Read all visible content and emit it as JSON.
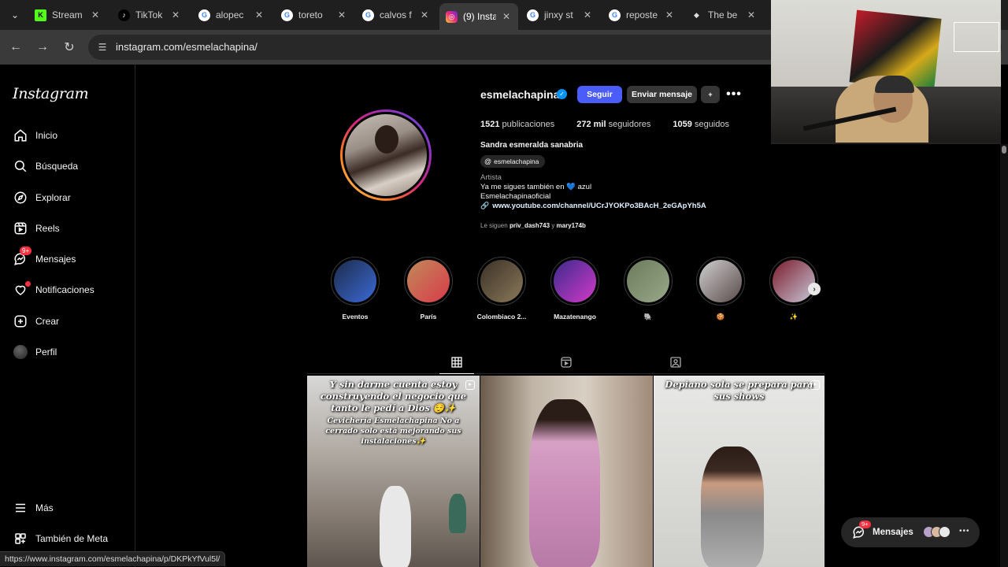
{
  "browser": {
    "tabs": [
      {
        "label": "Stream",
        "icon": "kick-icon",
        "active": false
      },
      {
        "label": "TikTok",
        "icon": "tiktok-icon",
        "active": false
      },
      {
        "label": "alopec",
        "icon": "google-icon",
        "active": false
      },
      {
        "label": "toreto",
        "icon": "google-icon",
        "active": false
      },
      {
        "label": "calvos f",
        "icon": "google-icon",
        "active": false
      },
      {
        "label": "(9) Insta",
        "icon": "instagram-icon",
        "active": true
      },
      {
        "label": "jinxy st",
        "icon": "google-icon",
        "active": false
      },
      {
        "label": "reposte",
        "icon": "google-icon",
        "active": false
      },
      {
        "label": "The be",
        "icon": "gemini-icon",
        "active": false
      }
    ],
    "url": "instagram.com/esmelachapina/",
    "status_url": "https://www.instagram.com/esmelachapina/p/DKPkYfVul5l/"
  },
  "sidebar": {
    "logo": "Instagram",
    "items": [
      {
        "label": "Inicio",
        "icon": "home-icon"
      },
      {
        "label": "Búsqueda",
        "icon": "search-icon"
      },
      {
        "label": "Explorar",
        "icon": "compass-icon"
      },
      {
        "label": "Reels",
        "icon": "reels-icon"
      },
      {
        "label": "Mensajes",
        "icon": "messenger-icon",
        "badge": "9+"
      },
      {
        "label": "Notificaciones",
        "icon": "heart-icon"
      },
      {
        "label": "Crear",
        "icon": "plus-square-icon"
      },
      {
        "label": "Perfil",
        "icon": "avatar"
      }
    ],
    "bottom": [
      {
        "label": "Más",
        "icon": "menu-icon"
      },
      {
        "label": "También de Meta",
        "icon": "meta-icon"
      }
    ]
  },
  "profile": {
    "username": "esmelachapina",
    "follow_label": "Seguir",
    "message_label": "Enviar mensaje",
    "suggest_label": "+",
    "stats": {
      "posts": "1521",
      "posts_label": "publicaciones",
      "followers": "272 mil",
      "followers_label": "seguidores",
      "following": "1059",
      "following_label": "seguidos"
    },
    "full_name": "Sandra esmeralda sanabria",
    "threads_handle": "esmelachapina",
    "category": "Artista",
    "bio_line1": "Ya me sigues también en",
    "bio_line1_emoji": "💙",
    "bio_line1_end": "azul",
    "bio_line2": "Esmelachapinaoficial",
    "link": "www.youtube.com/channel/UCrJYOKPo3BAcH_2eGApYh5A",
    "followed_by_prefix": "Le siguen",
    "followed_by_1": "priv_dash743",
    "followed_by_sep": "y",
    "followed_by_2": "mary174b"
  },
  "highlights": [
    {
      "label": "Eventos",
      "colors": [
        "#1d2a4a",
        "#3b6bd6"
      ]
    },
    {
      "label": "París",
      "colors": [
        "#c08a5a",
        "#d83a4a"
      ]
    },
    {
      "label": "Colombiaco 2...",
      "colors": [
        "#3a3026",
        "#8a7a5a"
      ]
    },
    {
      "label": "Mazatenango",
      "colors": [
        "#3a2a8a",
        "#d23ac8"
      ]
    },
    {
      "label": "🐘",
      "colors": [
        "#6a7a5a",
        "#9aa88a"
      ]
    },
    {
      "label": "🍪",
      "colors": [
        "#cfcfcf",
        "#5a4a4a"
      ]
    },
    {
      "label": "✨",
      "colors": [
        "#7a1a2a",
        "#c8c8d8"
      ]
    }
  ],
  "posts": [
    {
      "title": "Y sin darme cuenta estoy construyendo el negocio que tanto le pedí a Dios 😌✨",
      "subtitle": "Cevichería Esmelachapina No a cerrado solo está mejorando sus instalaciones✨"
    },
    {
      "title": "",
      "subtitle": ""
    },
    {
      "title": "Depiano sola se prepara para sus shows",
      "subtitle": ""
    }
  ],
  "floating_messages": {
    "label": "Mensajes",
    "badge": "9+"
  }
}
